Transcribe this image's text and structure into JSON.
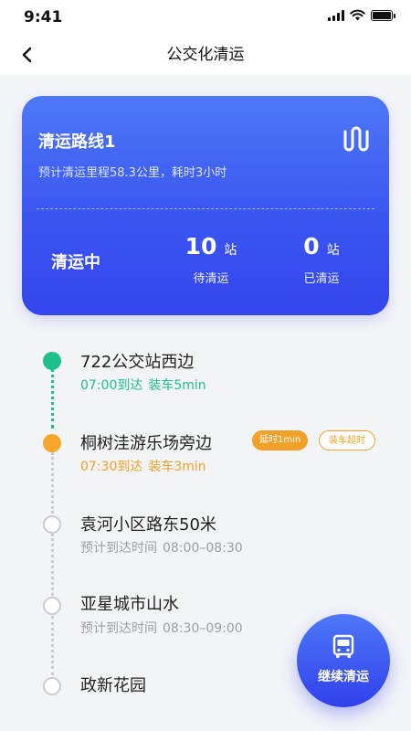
{
  "status_bar": {
    "time": "9:41"
  },
  "header": {
    "title": "公交化清运"
  },
  "route_card": {
    "name": "清运路线1",
    "description": "预计清运里程58.3公里，耗时3小时",
    "status": "清运中",
    "stats": [
      {
        "value": "10",
        "unit": "站",
        "label": "待清运"
      },
      {
        "value": "0",
        "unit": "站",
        "label": "已清运"
      }
    ]
  },
  "stops": [
    {
      "name": "722公交站西边",
      "arrive": "07:00到达",
      "load": "装车5min",
      "state": "done"
    },
    {
      "name": "桐树洼游乐场旁边",
      "arrive": "07:30到达",
      "load": "装车3min",
      "state": "active",
      "tags": [
        "延时1min",
        "装车超时"
      ]
    },
    {
      "name": "袁河小区路东50米",
      "eta_label": "预计到达时间",
      "eta": "08:00–08:30",
      "state": "pending"
    },
    {
      "name": "亚星城市山水",
      "eta_label": "预计到达时间",
      "eta": "08:30–09:00",
      "state": "pending"
    },
    {
      "name": "政新花园",
      "state": "pending"
    }
  ],
  "fab": {
    "label": "继续清运",
    "icon": "bus-icon"
  },
  "colors": {
    "primary": "#3d5cf2",
    "done": "#1fc08a",
    "warning": "#f0a127",
    "pending": "#c9ccd2"
  }
}
